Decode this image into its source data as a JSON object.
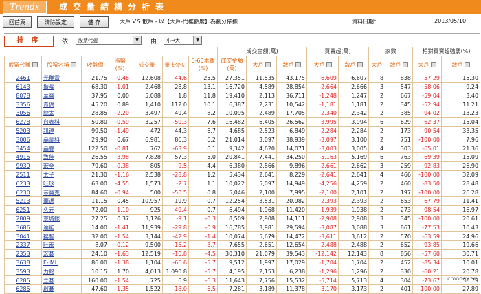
{
  "banner": {
    "logo": "Trendx",
    "title": "成交量結構分析表"
  },
  "toolbar": {
    "btn_back": "回首頁",
    "btn_clear": "清除設定",
    "btn_save": "儲 存",
    "desc": "大戶 V.S 散戶 - 以【大戶-門檻額度】為劃分依據",
    "date_label": "資料日期：",
    "date_value": "2013/05/10"
  },
  "sortbar": {
    "label": "排 序",
    "by": "依",
    "field": "股票代號",
    "by2": "由",
    "order": "小→大"
  },
  "groups": {
    "vol_amount": "成交金額(萬)",
    "net_buy": "買賣超(萬)",
    "count": "家數",
    "strength": "相對買賣超強弱(%)"
  },
  "headers": {
    "code": "股票代號",
    "name": "股票名稱",
    "price": "收盤價",
    "change_pct": "漲幅(%)",
    "volume": "成交量",
    "ratio": "量 比(%)",
    "vol_6_60": "6-60乖離(%)",
    "amount": "成交金額(萬)",
    "big": "大戶",
    "retail": "散戶",
    "nb_big": "大戶",
    "nb_retail": "散戶",
    "cnt_big": "大戶",
    "cnt_retail": "散戶",
    "st_big": "大戶",
    "st_retail": "散戶"
  },
  "rows": [
    [
      "2461",
      "光群雷",
      "21.75",
      "-0.46",
      "12,608",
      "-44.6",
      "25.5",
      "27,351",
      "11,535",
      "43,175",
      "-6,609",
      "6,607",
      "8",
      "838",
      "-57.29",
      "15.30"
    ],
    [
      "6143",
      "振曜",
      "68.30",
      "-1.01",
      "2,468",
      "28.8",
      "13.1",
      "16,720",
      "4,589",
      "28,854",
      "-2,664",
      "2,666",
      "3",
      "547",
      "-58.06",
      "9.24"
    ],
    [
      "8078",
      "華寶",
      "37.95",
      "0.00",
      "5,088",
      "1.8",
      "11.8",
      "19,410",
      "2,113",
      "36,711",
      "-1,248",
      "1,247",
      "2",
      "667",
      "-59.04",
      "3.40"
    ],
    [
      "3356",
      "奇偶",
      "45.20",
      "0.89",
      "1,410",
      "112.0",
      "10.1",
      "6,387",
      "2,231",
      "10,542",
      "-1,181",
      "1,181",
      "2",
      "345",
      "-52.94",
      "11.21"
    ],
    [
      "3056",
      "總太",
      "28.85",
      "-2.20",
      "3,497",
      "49.4",
      "8.2",
      "10,095",
      "2,489",
      "17,705",
      "-2,340",
      "2,342",
      "2",
      "385",
      "-94.02",
      "13.23"
    ],
    [
      "6278",
      "台表科",
      "50.80",
      "-0.59",
      "3,257",
      "-59.3",
      "7.6",
      "16,482",
      "6,405",
      "26,562",
      "-3,995",
      "3,994",
      "6",
      "629",
      "-62.37",
      "15.04"
    ],
    [
      "5203",
      "訊連",
      "99.50",
      "-1.49",
      "472",
      "44.3",
      "6.7",
      "4,685",
      "2,523",
      "6,849",
      "-2,284",
      "2,284",
      "2",
      "173",
      "-90.54",
      "33.35"
    ],
    [
      "3006",
      "晶豪科",
      "29.90",
      "0.67",
      "6,981",
      "86.3",
      "6.2",
      "21,014",
      "3,097",
      "38,939",
      "-3,097",
      "3,100",
      "2",
      "751",
      "-100.00",
      "7.96"
    ],
    [
      "3454",
      "晶睿",
      "122.50",
      "-0.81",
      "762",
      "-63.9",
      "6.1",
      "9,342",
      "4,620",
      "14,071",
      "-3,003",
      "3,005",
      "4",
      "303",
      "-65.01",
      "21.36"
    ],
    [
      "4915",
      "致伸",
      "26.55",
      "-3.98",
      "7,828",
      "57.3",
      "5.0",
      "20,841",
      "7,441",
      "34,250",
      "-5,163",
      "5,169",
      "6",
      "763",
      "-69.39",
      "15.09"
    ],
    [
      "9939",
      "宏全",
      "79.60",
      "-0.38",
      "805",
      "-9.5",
      "4.4",
      "6,380",
      "2,866",
      "9,896",
      "-2,661",
      "2,662",
      "3",
      "259",
      "-92.83",
      "26.90"
    ],
    [
      "2511",
      "太子",
      "21.30",
      "-1.16",
      "2,538",
      "-28.8",
      "1.2",
      "5,434",
      "2,641",
      "8,229",
      "-2,641",
      "2,641",
      "4",
      "466",
      "-100.00",
      "32.09"
    ],
    [
      "6233",
      "旺玖",
      "63.00",
      "-4.55",
      "1,573",
      "-2.7",
      "1.1",
      "10,022",
      "5,097",
      "14,949",
      "-4,256",
      "4,259",
      "2",
      "460",
      "-83.50",
      "28.48"
    ],
    [
      "6230",
      "帝寶克",
      "84.60",
      "-0.94",
      "500",
      "-50.5",
      "0.8",
      "5,046",
      "2,100",
      "7,995",
      "-2,100",
      "2,101",
      "2",
      "197",
      "-100.00",
      "26.28"
    ],
    [
      "5213",
      "華通",
      "11.15",
      "0.45",
      "10,957",
      "19.9",
      "0.7",
      "12,254",
      "3,531",
      "20,982",
      "-2,393",
      "2,393",
      "2",
      "653",
      "-67.79",
      "11.41"
    ],
    [
      "6251",
      "久元",
      "72.00",
      "-1.10",
      "925",
      "-49.4",
      "0.7",
      "6,494",
      "1,968",
      "11,420",
      "-1,939",
      "1,938",
      "2",
      "273",
      "-98.54",
      "16.97"
    ],
    [
      "2809",
      "京城銀",
      "27.25",
      "0.37",
      "3,126",
      "-9.1",
      "-0.3",
      "8,509",
      "2,908",
      "14,111",
      "-2,908",
      "2,908",
      "3",
      "345",
      "-100.00",
      "20.61"
    ],
    [
      "3686",
      "達能",
      "14.00",
      "-1.41",
      "11,939",
      "-29.8",
      "-0.9",
      "16,785",
      "3,981",
      "29,594",
      "-3,087",
      "3,088",
      "3",
      "861",
      "-77.53",
      "10.43"
    ],
    [
      "3041",
      "揚智",
      "32.00",
      "-1.54",
      "3,144",
      "-42.9",
      "-1.4",
      "10,074",
      "5,679",
      "14,472",
      "-3,611",
      "3,612",
      "2",
      "570",
      "-63.59",
      "24.96"
    ],
    [
      "2337",
      "旺宏",
      "8.07",
      "-0.12",
      "9,500",
      "-15.2",
      "-3.7",
      "7,655",
      "2,651",
      "12,654",
      "-2,488",
      "2,488",
      "2",
      "652",
      "-93.85",
      "19.66"
    ],
    [
      "2353",
      "宏碁",
      "24.10",
      "-1.63",
      "12,519",
      "-10.8",
      "-4.5",
      "30,310",
      "21,079",
      "39,543",
      "-12,142",
      "12,143",
      "8",
      "856",
      "-57.60",
      "30.71"
    ],
    [
      "3638",
      "F-IML",
      "86.00",
      "-1.38",
      "1,104",
      "-66.6",
      "-5.7",
      "9,512",
      "1,997",
      "17,029",
      "-1,704",
      "1,704",
      "2",
      "452",
      "-85.34",
      "10.01"
    ],
    [
      "3593",
      "力銘",
      "10.15",
      "1.70",
      "4,013",
      "1,090.8",
      "-5.7",
      "4,195",
      "2,153",
      "6,238",
      "-1,296",
      "1,296",
      "2",
      "330",
      "-60.21",
      "20.78"
    ],
    [
      "6285",
      "立碁",
      "160.00",
      "-1.54",
      "725",
      "6.9",
      "-6.3",
      "11,643",
      "7,756",
      "15,532",
      "-5,714",
      "5,713",
      "4",
      "304",
      "-73.67",
      "36.79"
    ],
    [
      "6285",
      "啟碁",
      "47.60",
      "-1.35",
      "1,522",
      "-18.0",
      "-6.5",
      "7,281",
      "3,189",
      "11,378",
      "-3,170",
      "3,173",
      "2",
      "401",
      "-100.00",
      "27.89"
    ]
  ],
  "watermark": "cmoney.tw",
  "colors": {
    "banner": "#f08a1c",
    "neg": "#e02020",
    "link": "#1f3fa0",
    "header": "#e06510"
  }
}
